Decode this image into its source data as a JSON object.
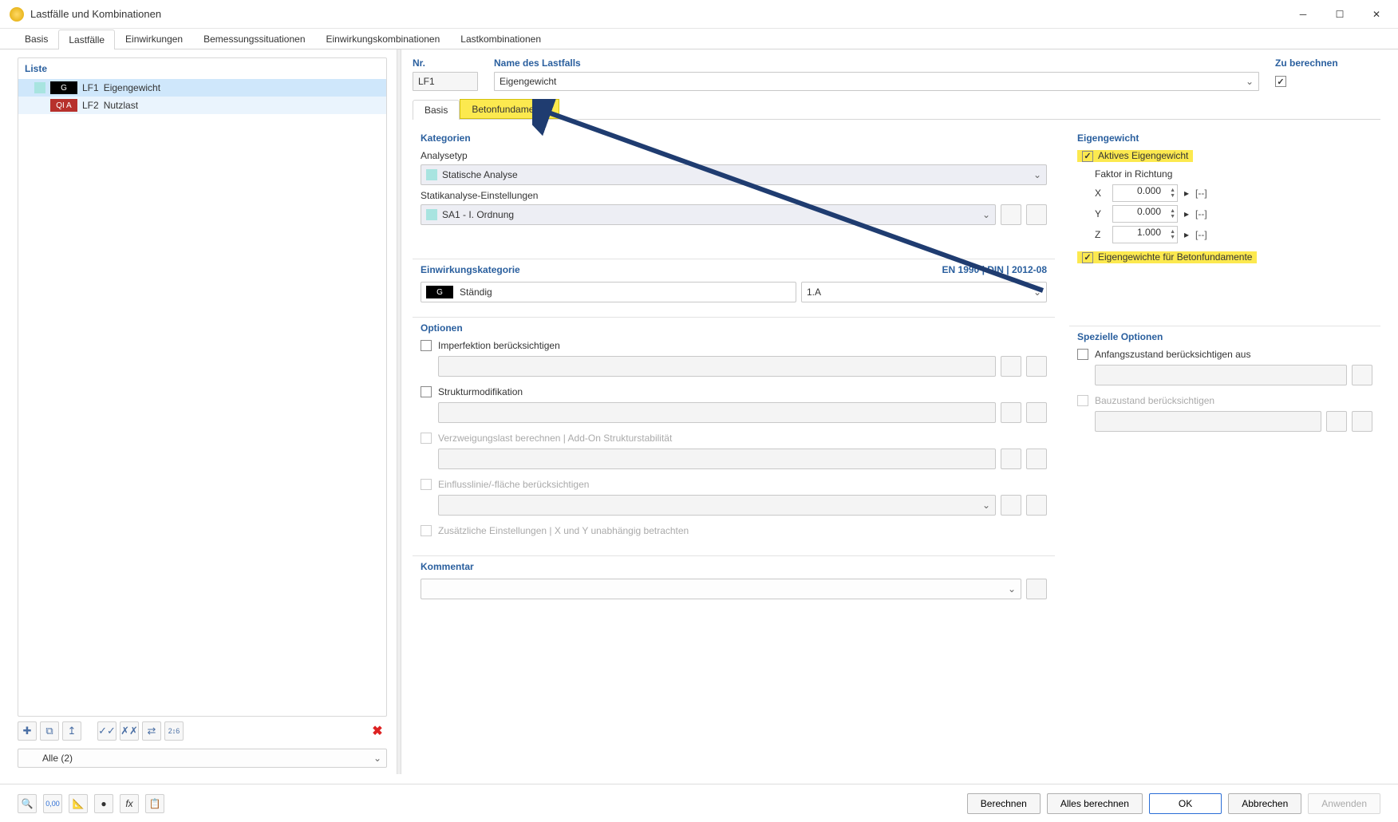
{
  "window": {
    "title": "Lastfälle und Kombinationen"
  },
  "mainTabs": [
    "Basis",
    "Lastfälle",
    "Einwirkungen",
    "Bemessungssituationen",
    "Einwirkungskombinationen",
    "Lastkombinationen"
  ],
  "mainTabActive": 1,
  "leftPane": {
    "header": "Liste"
  },
  "list": [
    {
      "badge": "G",
      "badgeCls": "g",
      "code": "LF1",
      "name": "Eigengewicht",
      "selected": true
    },
    {
      "badge": "QI A",
      "badgeCls": "qi",
      "code": "LF2",
      "name": "Nutzlast",
      "selected": false
    }
  ],
  "filter": {
    "label": "Alle (2)"
  },
  "topFields": {
    "nrLabel": "Nr.",
    "nrVal": "LF1",
    "nameLabel": "Name des Lastfalls",
    "nameVal": "Eigengewicht",
    "calcLabel": "Zu berechnen"
  },
  "subTabs": [
    "Basis",
    "Betonfundamente"
  ],
  "subTabActive": 0,
  "sections": {
    "kategorien": {
      "title": "Kategorien",
      "analysetypLabel": "Analysetyp",
      "analysetypVal": "Statische Analyse",
      "statikLabel": "Statikanalyse-Einstellungen",
      "statikVal": "SA1 - I. Ordnung"
    },
    "einwirkung": {
      "title": "Einwirkungskategorie",
      "norm": "EN 1990 | DIN | 2012-08",
      "val": "Ständig",
      "code": "1.A"
    },
    "optionen": {
      "title": "Optionen",
      "imperfektion": "Imperfektion berücksichtigen",
      "struktur": "Strukturmodifikation",
      "verzweigung": "Verzweigungslast berechnen | Add-On Strukturstabilität",
      "einfluss": "Einflusslinie/-fläche berücksichtigen",
      "zusatz": "Zusätzliche Einstellungen | X und Y unabhängig betrachten"
    },
    "eigengewicht": {
      "title": "Eigengewicht",
      "aktiv": "Aktives Eigengewicht",
      "faktor": "Faktor in Richtung",
      "x": "0.000",
      "y": "0.000",
      "z": "1.000",
      "unit": "[--]",
      "beton": "Eigengewichte für Betonfundamente"
    },
    "spezielle": {
      "title": "Spezielle Optionen",
      "anfang": "Anfangszustand berücksichtigen aus",
      "bauzustand": "Bauzustand berücksichtigen"
    },
    "kommentar": {
      "title": "Kommentar"
    }
  },
  "footer": {
    "berechnen": "Berechnen",
    "alles": "Alles berechnen",
    "ok": "OK",
    "abbrechen": "Abbrechen",
    "anwenden": "Anwenden"
  }
}
